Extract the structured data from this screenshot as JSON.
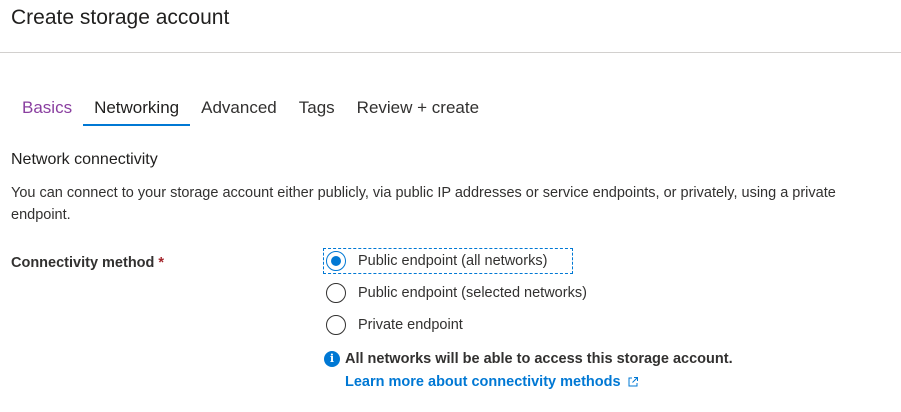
{
  "page": {
    "title": "Create storage account"
  },
  "tabs": [
    {
      "label": "Basics",
      "state": "visited"
    },
    {
      "label": "Networking",
      "state": "active"
    },
    {
      "label": "Advanced",
      "state": "default"
    },
    {
      "label": "Tags",
      "state": "default"
    },
    {
      "label": "Review + create",
      "state": "default"
    }
  ],
  "section": {
    "heading": "Network connectivity",
    "description": "You can connect to your storage account either publicly, via public IP addresses or service endpoints, or privately, using a private endpoint."
  },
  "connectivity": {
    "label": "Connectivity method",
    "required_marker": "*",
    "options": [
      {
        "label": "Public endpoint (all networks)",
        "selected": true
      },
      {
        "label": "Public endpoint (selected networks)",
        "selected": false
      },
      {
        "label": "Private endpoint",
        "selected": false
      }
    ],
    "selected_value": "Public endpoint (all networks)"
  },
  "info": {
    "icon": "info-icon",
    "icon_glyph": "i",
    "message": "All networks will be able to access this storage account.",
    "link_text": "Learn more about connectivity methods",
    "link_icon": "external-link-icon"
  },
  "colors": {
    "accent": "#0078d4",
    "visited_tab": "#8a3fa0",
    "required": "#a4262c",
    "text": "#323130"
  }
}
